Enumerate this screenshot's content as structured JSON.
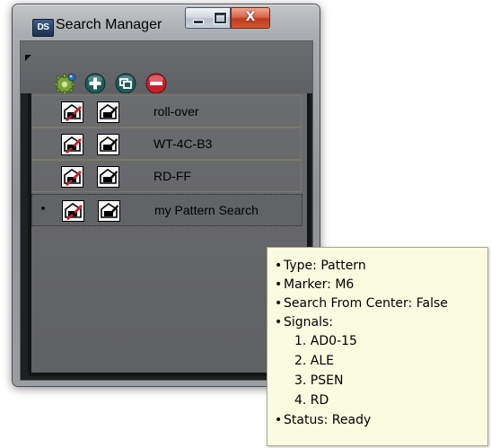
{
  "window": {
    "title": "Search Manager",
    "app_icon_text": "DS"
  },
  "caption_buttons": {
    "close_glyph": "X"
  },
  "toolbar": {
    "buttons": [
      {
        "name": "settings",
        "icon": "gear-icon",
        "color": "#7aa33a"
      },
      {
        "name": "add",
        "icon": "plus-icon",
        "color": "#1f5a5a"
      },
      {
        "name": "duplicate",
        "icon": "copy-icon",
        "color": "#1f5a5a"
      },
      {
        "name": "remove",
        "icon": "minus-icon",
        "color": "#c8202a"
      }
    ]
  },
  "searches": [
    {
      "label": "roll-over",
      "selected": false
    },
    {
      "label": "WT-4C-B3",
      "selected": false
    },
    {
      "label": "RD-FF",
      "selected": false
    },
    {
      "label": "my Pattern Search",
      "selected": true
    }
  ],
  "tooltip": {
    "type": "Type: Pattern",
    "marker": "Marker: M6",
    "search_from_center": "Search From Center: False",
    "signals_header": "Signals:",
    "signals": [
      "1. AD0-15",
      "2. ALE",
      "3. PSEN",
      "4. RD"
    ],
    "status": "Status: Ready"
  },
  "colors": {
    "tooltip_bg": "#fbfbe0",
    "list_bg": "#656669",
    "remove_red": "#c8202a",
    "action_teal": "#1f5a5a"
  }
}
